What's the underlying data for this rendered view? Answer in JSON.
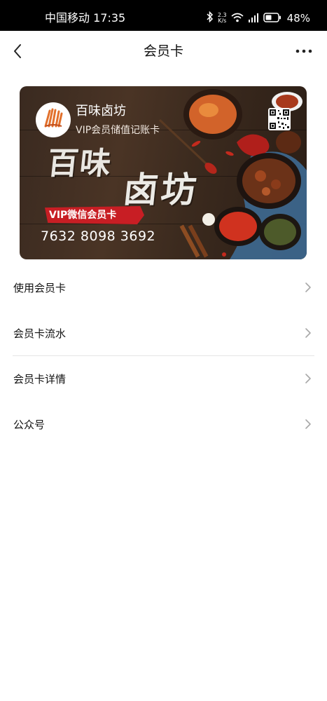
{
  "status_bar": {
    "carrier_time": "中国移动 17:35",
    "speed_value": "2.3",
    "speed_unit": "K/s",
    "battery_percent": "48%"
  },
  "nav": {
    "title": "会员卡",
    "back_icon": "chevron-left-icon",
    "more_icon": "more-dots-icon"
  },
  "card": {
    "brand_name": "百味卤坊",
    "subtitle": "VIP会员储值记账卡",
    "calligraphy_line1": "百味",
    "calligraphy_line2": "卤坊",
    "banner_text": "VIP微信会员卡",
    "card_number": "7632 8098 3692",
    "logo_text": "百味卤坊",
    "colors": {
      "banner": "#c81e24",
      "wood": "#3b2a1e"
    }
  },
  "menu": [
    {
      "label": "使用会员卡"
    },
    {
      "label": "会员卡流水"
    },
    {
      "label": "会员卡详情"
    },
    {
      "label": "公众号"
    }
  ]
}
